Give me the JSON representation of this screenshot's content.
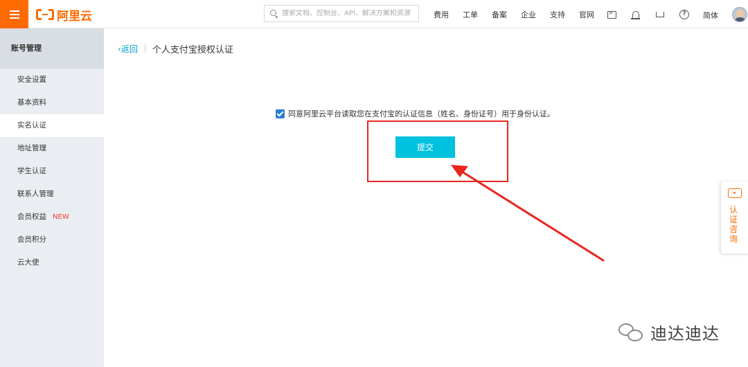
{
  "header": {
    "logo_text": "阿里云",
    "search_placeholder": "搜索文档、控制台、API、解决方案和资源",
    "nav": [
      "费用",
      "工单",
      "备案",
      "企业",
      "支持",
      "官网"
    ],
    "lang": "简体"
  },
  "sidebar": {
    "title": "账号管理",
    "items": [
      {
        "label": "安全设置"
      },
      {
        "label": "基本资料"
      },
      {
        "label": "实名认证",
        "active": true
      },
      {
        "label": "地址管理"
      },
      {
        "label": "学生认证"
      },
      {
        "label": "联系人管理"
      },
      {
        "label": "会员权益",
        "badge": "NEW"
      },
      {
        "label": "会员积分"
      },
      {
        "label": "云大使"
      }
    ]
  },
  "main": {
    "back_label": "返回",
    "title": "个人支付宝授权认证",
    "agree_text": "同意阿里云平台读取您在支付宝的认证信息（姓名、身份证号）用于身份认证。",
    "agree_checked": true,
    "submit_label": "提交"
  },
  "consult": {
    "label": "认证咨询"
  },
  "watermark": {
    "text": "迪达迪达"
  },
  "colors": {
    "brand": "#ff6a00",
    "accent": "#00c1de",
    "link": "#00a2ca",
    "annotation": "#e8251f"
  }
}
